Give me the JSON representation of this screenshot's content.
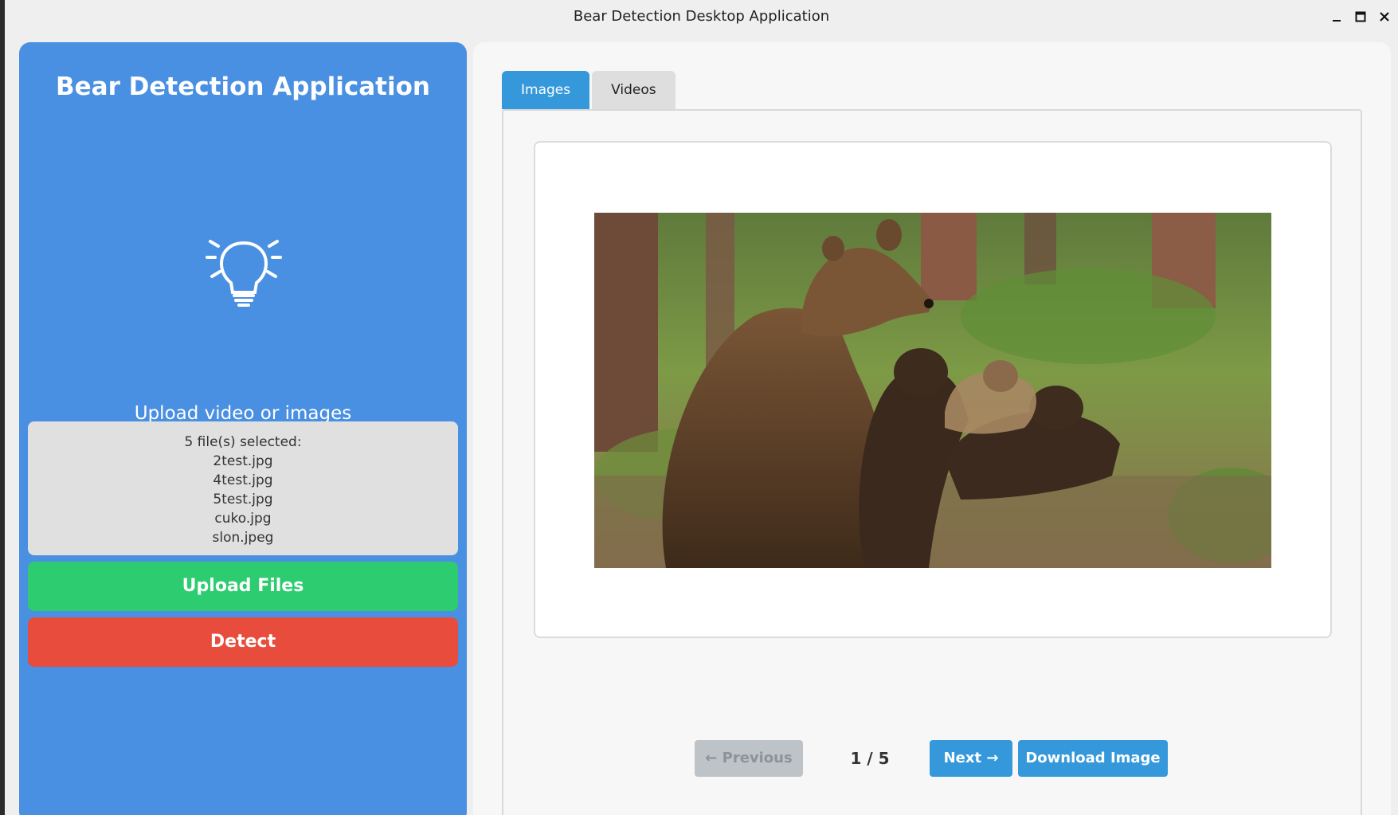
{
  "window": {
    "title": "Bear Detection Desktop Application",
    "controls": [
      "minimize-icon",
      "maximize-icon",
      "close-icon"
    ]
  },
  "sidebar": {
    "title": "Bear Detection Application",
    "icon": "lightbulb-icon",
    "upload_caption": "Upload video or images",
    "file_summary": "5 file(s) selected:",
    "files": [
      "2test.jpg",
      "4test.jpg",
      "5test.jpg",
      "cuko.jpg",
      "slon.jpeg"
    ],
    "upload_label": "Upload Files",
    "detect_label": "Detect",
    "colors": {
      "panel": "#4a90e2",
      "upload": "#2ecc71",
      "detect": "#e74c3c"
    }
  },
  "main": {
    "tabs": [
      {
        "label": "Images",
        "active": true
      },
      {
        "label": "Videos",
        "active": false
      }
    ],
    "image_subject": "brown bear with cubs in forest",
    "pager": {
      "prev_label": "← Previous",
      "page_text": "1 / 5",
      "next_label": "Next →",
      "download_label": "Download Image"
    },
    "colors": {
      "accent": "#3498db",
      "disabled": "#bdc3c7"
    }
  }
}
